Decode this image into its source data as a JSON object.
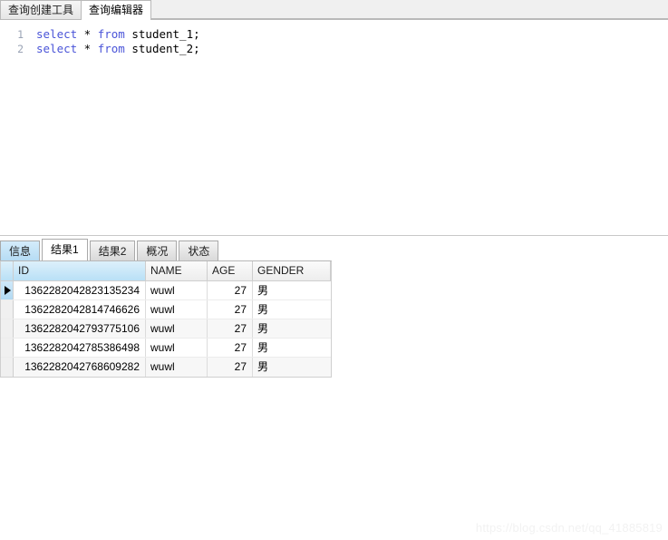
{
  "top_tabs": [
    {
      "label": "查询创建工具",
      "active": false
    },
    {
      "label": "查询编辑器",
      "active": true
    }
  ],
  "editor": {
    "lines": [
      {
        "number": "1",
        "keyword1": "select",
        "star": " * ",
        "keyword2": "from",
        "table": " student_1",
        "terminator": ";"
      },
      {
        "number": "2",
        "keyword1": "select",
        "star": " * ",
        "keyword2": "from",
        "table": " student_2",
        "terminator": ";"
      }
    ]
  },
  "result_tabs": [
    {
      "label": "信息",
      "state": "highlight"
    },
    {
      "label": "结果1",
      "state": "active"
    },
    {
      "label": "结果2",
      "state": "normal"
    },
    {
      "label": "概况",
      "state": "normal"
    },
    {
      "label": "状态",
      "state": "normal"
    }
  ],
  "grid": {
    "columns": [
      "ID",
      "NAME",
      "AGE",
      "GENDER"
    ],
    "rows": [
      {
        "id": "1362282042823135234",
        "name": "wuwl",
        "age": "27",
        "gender": "男"
      },
      {
        "id": "1362282042814746626",
        "name": "wuwl",
        "age": "27",
        "gender": "男"
      },
      {
        "id": "1362282042793775106",
        "name": "wuwl",
        "age": "27",
        "gender": "男"
      },
      {
        "id": "1362282042785386498",
        "name": "wuwl",
        "age": "27",
        "gender": "男"
      },
      {
        "id": "1362282042768609282",
        "name": "wuwl",
        "age": "27",
        "gender": "男"
      }
    ],
    "current_row_index": 0
  },
  "watermark": {
    "text": "https://blog.csdn.net/qq_41885819"
  },
  "colors": {
    "keyword": "#4a54d8",
    "header_selected": "#b9e0f6",
    "tab_highlight": "#b6dcf4",
    "grid_border": "#cfcfcf"
  }
}
